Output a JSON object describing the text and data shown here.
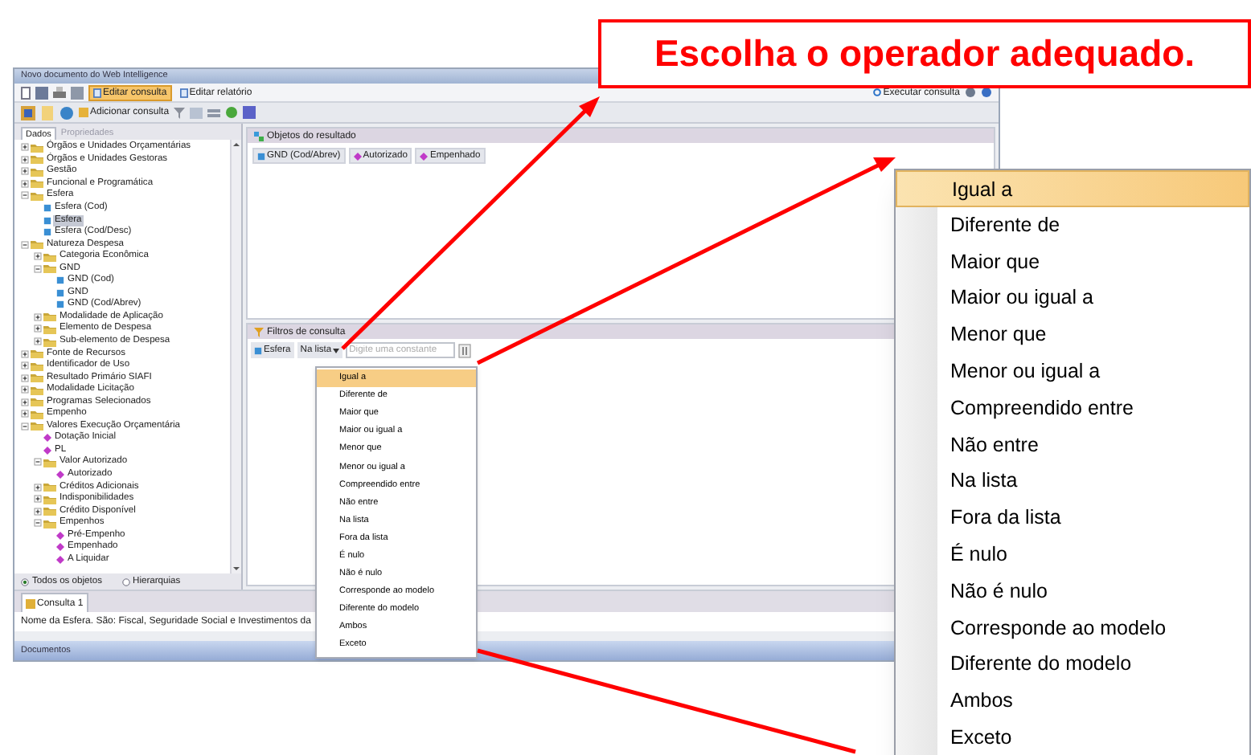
{
  "window": {
    "title": "Novo documento do Web Intelligence"
  },
  "toolbar": {
    "buttons": [
      {
        "label": "Editar consulta",
        "selected": true
      },
      {
        "label": "Editar relatório",
        "selected": false
      }
    ],
    "run": {
      "label": "Executar consulta"
    }
  },
  "query_toolbar": {
    "add": {
      "label": "Adicionar consulta"
    }
  },
  "left_panel": {
    "tabs": [
      {
        "label": "Dados",
        "selected": true
      },
      {
        "label": "Propriedades",
        "selected": false
      }
    ],
    "tree": [
      {
        "label": "Órgãos e Unidades Orçamentárias",
        "kind": "folder",
        "expanded": false,
        "selected": false
      },
      {
        "label": "Órgãos e Unidades Gestoras",
        "kind": "folder",
        "expanded": false,
        "selected": false
      },
      {
        "label": "Gestão",
        "kind": "folder",
        "expanded": false,
        "selected": false
      },
      {
        "label": "Funcional e Programática",
        "kind": "folder",
        "expanded": false,
        "selected": false
      },
      {
        "label": "Esfera",
        "kind": "folder",
        "expanded": true,
        "selected": false,
        "children": [
          {
            "label": "Esfera (Cod)",
            "kind": "dimension",
            "selected": false
          },
          {
            "label": "Esfera",
            "kind": "dimension",
            "selected": true
          },
          {
            "label": "Esfera (Cod/Desc)",
            "kind": "dimension",
            "selected": false
          }
        ]
      },
      {
        "label": "Natureza Despesa",
        "kind": "folder",
        "expanded": true,
        "selected": false,
        "children": [
          {
            "label": "Categoria Econômica",
            "kind": "folder",
            "expanded": false,
            "selected": false
          },
          {
            "label": "GND",
            "kind": "folder",
            "expanded": true,
            "selected": false,
            "children": [
              {
                "label": "GND (Cod)",
                "kind": "dimension",
                "selected": false
              },
              {
                "label": "GND",
                "kind": "dimension",
                "selected": false
              },
              {
                "label": "GND (Cod/Abrev)",
                "kind": "dimension",
                "selected": false
              }
            ]
          },
          {
            "label": "Modalidade de Aplicação",
            "kind": "folder",
            "expanded": false,
            "selected": false
          },
          {
            "label": "Elemento de Despesa",
            "kind": "folder",
            "expanded": false,
            "selected": false
          },
          {
            "label": "Sub-elemento de Despesa",
            "kind": "folder",
            "expanded": false,
            "selected": false
          }
        ]
      },
      {
        "label": "Fonte de Recursos",
        "kind": "folder",
        "expanded": false,
        "selected": false
      },
      {
        "label": "Identificador de Uso",
        "kind": "folder",
        "expanded": false,
        "selected": false
      },
      {
        "label": "Resultado Primário SIAFI",
        "kind": "folder",
        "expanded": false,
        "selected": false
      },
      {
        "label": "Modalidade Licitação",
        "kind": "folder",
        "expanded": false,
        "selected": false
      },
      {
        "label": "Programas Selecionados",
        "kind": "folder",
        "expanded": false,
        "selected": false
      },
      {
        "label": "Empenho",
        "kind": "folder",
        "expanded": false,
        "selected": false
      },
      {
        "label": "Valores Execução Orçamentária",
        "kind": "folder",
        "expanded": true,
        "selected": false,
        "children": [
          {
            "label": "Dotação Inicial",
            "kind": "measure",
            "selected": false
          },
          {
            "label": "PL",
            "kind": "measure",
            "selected": false
          },
          {
            "label": "Valor Autorizado",
            "kind": "folder",
            "expanded": true,
            "selected": false,
            "children": [
              {
                "label": "Autorizado",
                "kind": "measure",
                "selected": false
              }
            ]
          },
          {
            "label": "Créditos Adicionais",
            "kind": "folder",
            "expanded": false,
            "selected": false
          },
          {
            "label": "Indisponibilidades",
            "kind": "folder",
            "expanded": false,
            "selected": false
          },
          {
            "label": "Crédito Disponível",
            "kind": "folder",
            "expanded": false,
            "selected": false
          },
          {
            "label": "Empenhos",
            "kind": "folder",
            "expanded": true,
            "selected": false,
            "children": [
              {
                "label": "Pré-Empenho",
                "kind": "measure",
                "selected": false
              },
              {
                "label": "Empenhado",
                "kind": "measure",
                "selected": false
              },
              {
                "label": "A Liquidar",
                "kind": "measure",
                "selected": false
              }
            ]
          }
        ]
      }
    ],
    "view_options": [
      {
        "label": "Todos os objetos",
        "selected": true
      },
      {
        "label": "Hierarquias",
        "selected": false
      }
    ]
  },
  "result_objects": {
    "title": "Objetos do resultado",
    "items": [
      {
        "label": "GND (Cod/Abrev)",
        "kind": "dimension"
      },
      {
        "label": "Autorizado",
        "kind": "measure"
      },
      {
        "label": "Empenhado",
        "kind": "measure"
      }
    ]
  },
  "query_filters": {
    "title": "Filtros de consulta",
    "filter": {
      "object": "Esfera",
      "operator": "Na lista",
      "placeholder": "Digite uma constante"
    }
  },
  "operator_menu": {
    "items": [
      {
        "label": "Igual a",
        "selected": true
      },
      {
        "label": "Diferente de",
        "selected": false
      },
      {
        "label": "Maior que",
        "selected": false
      },
      {
        "label": "Maior ou igual a",
        "selected": false
      },
      {
        "label": "Menor que",
        "selected": false
      },
      {
        "label": "Menor ou igual a",
        "selected": false
      },
      {
        "label": "Compreendido entre",
        "selected": false
      },
      {
        "label": "Não entre",
        "selected": false
      },
      {
        "label": "Na lista",
        "selected": false
      },
      {
        "label": "Fora da lista",
        "selected": false
      },
      {
        "label": "É nulo",
        "selected": false
      },
      {
        "label": "Não é nulo",
        "selected": false
      },
      {
        "label": "Corresponde ao modelo",
        "selected": false
      },
      {
        "label": "Diferente do modelo",
        "selected": false
      },
      {
        "label": "Ambos",
        "selected": false
      },
      {
        "label": "Exceto",
        "selected": false
      }
    ]
  },
  "query_tabs": [
    {
      "label": "Consulta 1",
      "selected": true
    }
  ],
  "description": "Nome da Esfera. São: Fiscal, Seguridade Social e Investimentos da",
  "status_bar": {
    "text": "Documentos"
  },
  "callout": {
    "text": "Escolha o operador adequado."
  },
  "zoomed_menu": {
    "items": [
      {
        "label": "Igual a",
        "selected": true
      },
      {
        "label": "Diferente de",
        "selected": false
      },
      {
        "label": "Maior que",
        "selected": false
      },
      {
        "label": "Maior ou igual a",
        "selected": false
      },
      {
        "label": "Menor que",
        "selected": false
      },
      {
        "label": "Menor ou igual a",
        "selected": false
      },
      {
        "label": "Compreendido entre",
        "selected": false
      },
      {
        "label": "Não entre",
        "selected": false
      },
      {
        "label": "Na lista",
        "selected": false
      },
      {
        "label": "Fora da lista",
        "selected": false
      },
      {
        "label": "É nulo",
        "selected": false
      },
      {
        "label": "Não é nulo",
        "selected": false
      },
      {
        "label": "Corresponde ao modelo",
        "selected": false
      },
      {
        "label": "Diferente do modelo",
        "selected": false
      },
      {
        "label": "Ambos",
        "selected": false
      },
      {
        "label": "Exceto",
        "selected": false
      }
    ]
  }
}
